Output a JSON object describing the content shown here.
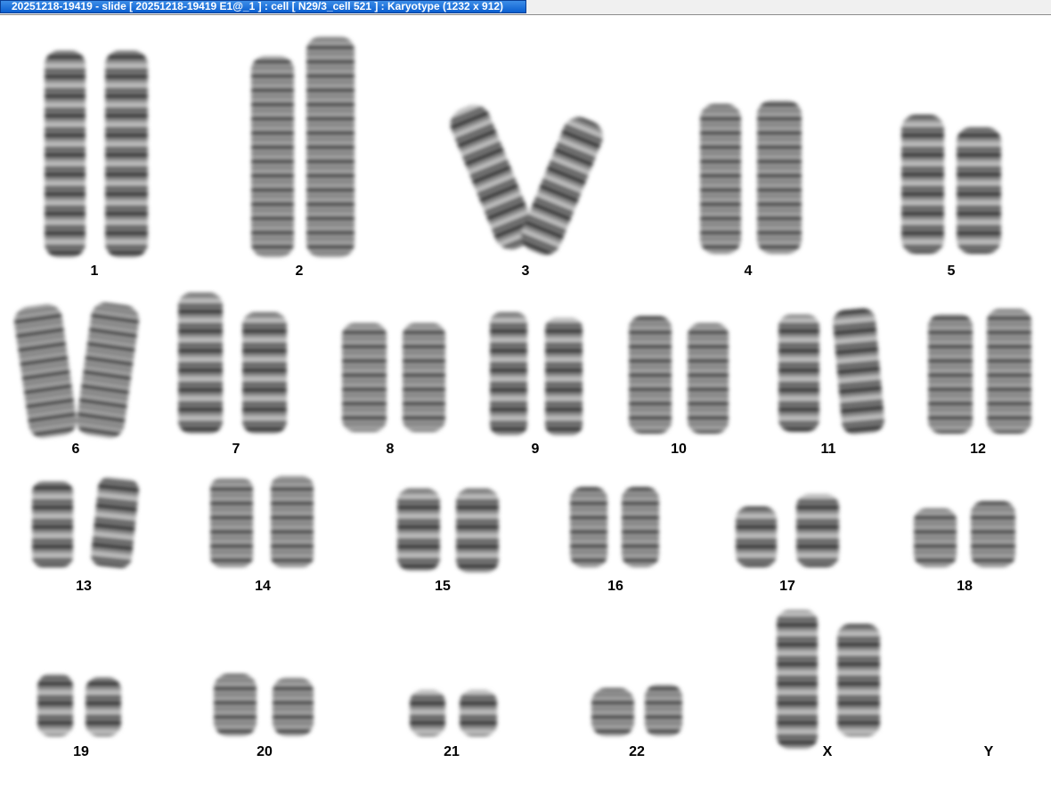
{
  "window": {
    "title": "20251218-19419 - slide [ 20251218-19419 E1@_1 ] : cell [ N29/3_cell 521 ] : Karyotype  (1232 x 912)"
  },
  "karyotype": {
    "labels": [
      "1",
      "2",
      "3",
      "4",
      "5",
      "6",
      "7",
      "8",
      "9",
      "10",
      "11",
      "12",
      "13",
      "14",
      "15",
      "16",
      "17",
      "18",
      "19",
      "20",
      "21",
      "22",
      "X",
      "Y"
    ]
  }
}
